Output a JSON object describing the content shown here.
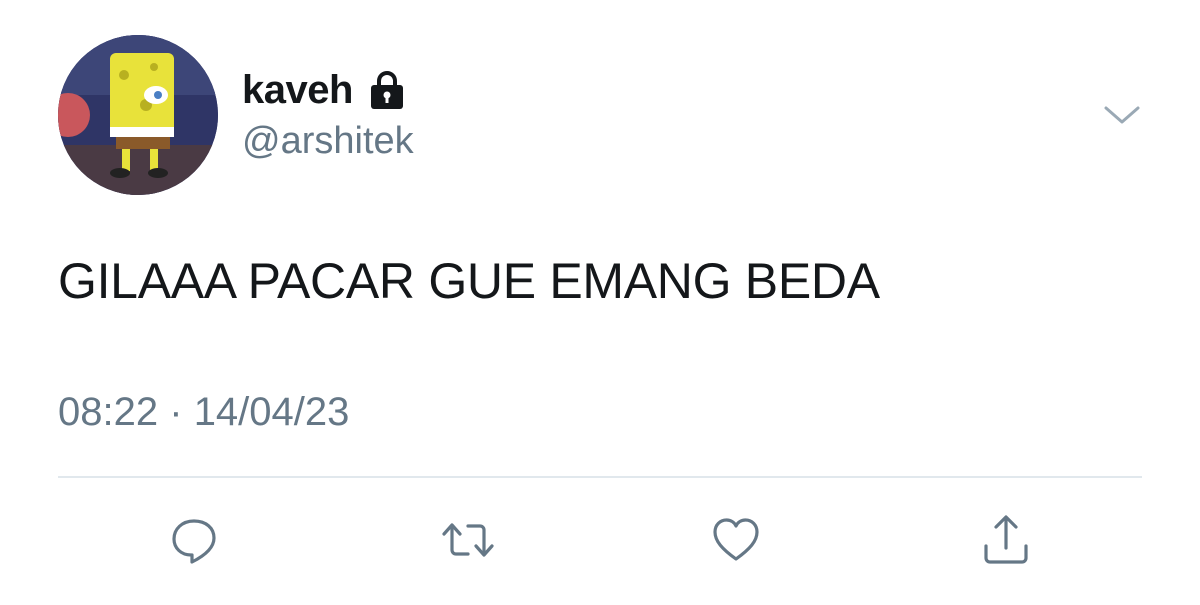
{
  "tweet": {
    "display_name": "kaveh",
    "handle": "@arshitek",
    "text": "GILAAA PACAR GUE EMANG BEDA",
    "time": "08:22",
    "separator": "·",
    "date": "14/04/23",
    "protected": true
  },
  "icons": {
    "lock": "lock-icon",
    "menu": "chevron-down-icon",
    "reply": "reply-icon",
    "retweet": "retweet-icon",
    "like": "heart-icon",
    "share": "share-icon"
  },
  "colors": {
    "text_primary": "#14171a",
    "text_secondary": "#657786",
    "icon": "#657786",
    "divider": "#e1e8ed"
  }
}
